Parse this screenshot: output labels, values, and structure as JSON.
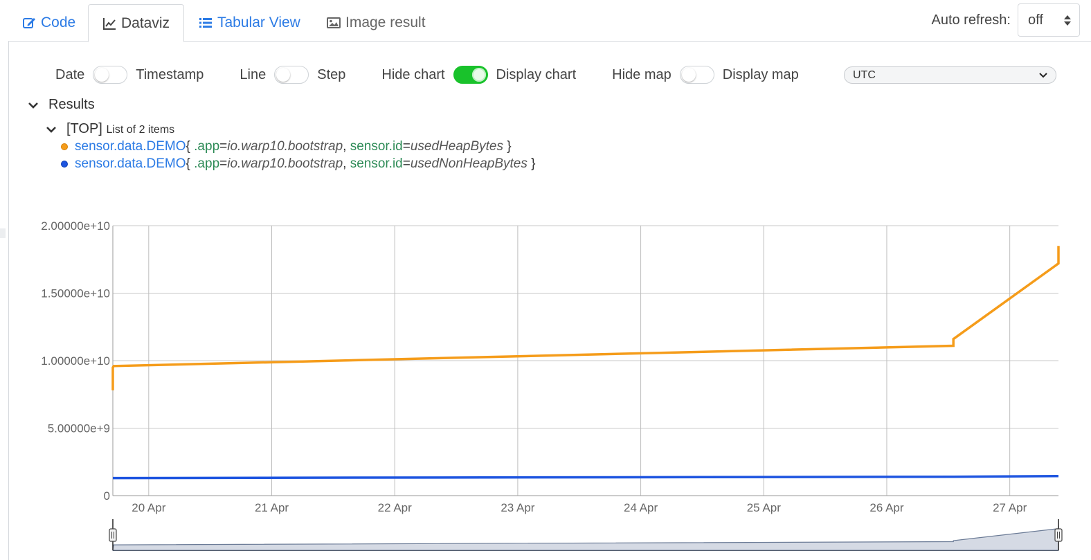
{
  "tabs": [
    {
      "label": "Code",
      "icon": "edit-icon",
      "active": false
    },
    {
      "label": "Dataviz",
      "icon": "line-chart-icon",
      "active": true
    },
    {
      "label": "Tabular View",
      "icon": "list-icon",
      "active": false
    },
    {
      "label": "Image result",
      "icon": "image-icon",
      "active": false
    }
  ],
  "auto_refresh": {
    "label": "Auto refresh:",
    "value": "off"
  },
  "toggles": {
    "date": "Date",
    "timestamp": "Timestamp",
    "line": "Line",
    "step": "Step",
    "hide_chart": "Hide chart",
    "display_chart": "Display chart",
    "hide_map": "Hide map",
    "display_map": "Display map",
    "timezone": "UTC"
  },
  "tree": {
    "results_label": "Results",
    "top_label": "[TOP]",
    "top_count": "List of 2 items",
    "series": [
      {
        "class": "sensor.data.DEMO",
        "k1": ".app",
        "v1": "io.warp10.bootstrap",
        "k2": "sensor.id",
        "v2": "usedHeapBytes",
        "color": "#f59c1a"
      },
      {
        "class": "sensor.data.DEMO",
        "k1": ".app",
        "v1": "io.warp10.bootstrap",
        "k2": "sensor.id",
        "v2": "usedNonHeapBytes",
        "color": "#1e55e0"
      }
    ],
    "open_brace": "{ ",
    "close_brace": " }",
    "eq": "=",
    "sep": ", "
  },
  "chart_data": {
    "type": "line",
    "xlabel": "",
    "ylabel": "",
    "ylim": [
      0,
      20000000000
    ],
    "yticks": [
      0,
      5000000000,
      10000000000,
      15000000000,
      20000000000
    ],
    "ytick_labels": [
      "0",
      "5.00000e+9",
      "1.00000e+10",
      "1.50000e+10",
      "2.00000e+10"
    ],
    "x_start": "2020-04-19T17:00:00Z",
    "x_end": "2020-04-27T09:30:00Z",
    "xticks": [
      "2020-04-20",
      "2020-04-21",
      "2020-04-22",
      "2020-04-23",
      "2020-04-24",
      "2020-04-25",
      "2020-04-26",
      "2020-04-27"
    ],
    "xtick_labels": [
      "20 Apr",
      "21 Apr",
      "22 Apr",
      "23 Apr",
      "24 Apr",
      "25 Apr",
      "26 Apr",
      "27 Apr"
    ],
    "grid": true,
    "series": [
      {
        "color": "#f59c1a",
        "points": [
          [
            "2020-04-19T17:00:00Z",
            7800000000
          ],
          [
            "2020-04-19T17:00:00Z",
            9500000000
          ],
          [
            "2020-04-19T17:10:00Z",
            9600000000
          ],
          [
            "2020-04-26T13:00:00Z",
            11100000000
          ],
          [
            "2020-04-26T13:00:00Z",
            11600000000
          ],
          [
            "2020-04-27T09:30:00Z",
            17200000000
          ],
          [
            "2020-04-27T09:30:00Z",
            18500000000
          ]
        ]
      },
      {
        "color": "#1e55e0",
        "points": [
          [
            "2020-04-19T17:00:00Z",
            1300000000
          ],
          [
            "2020-04-26T13:00:00Z",
            1400000000
          ],
          [
            "2020-04-27T09:30:00Z",
            1450000000
          ]
        ]
      }
    ]
  }
}
